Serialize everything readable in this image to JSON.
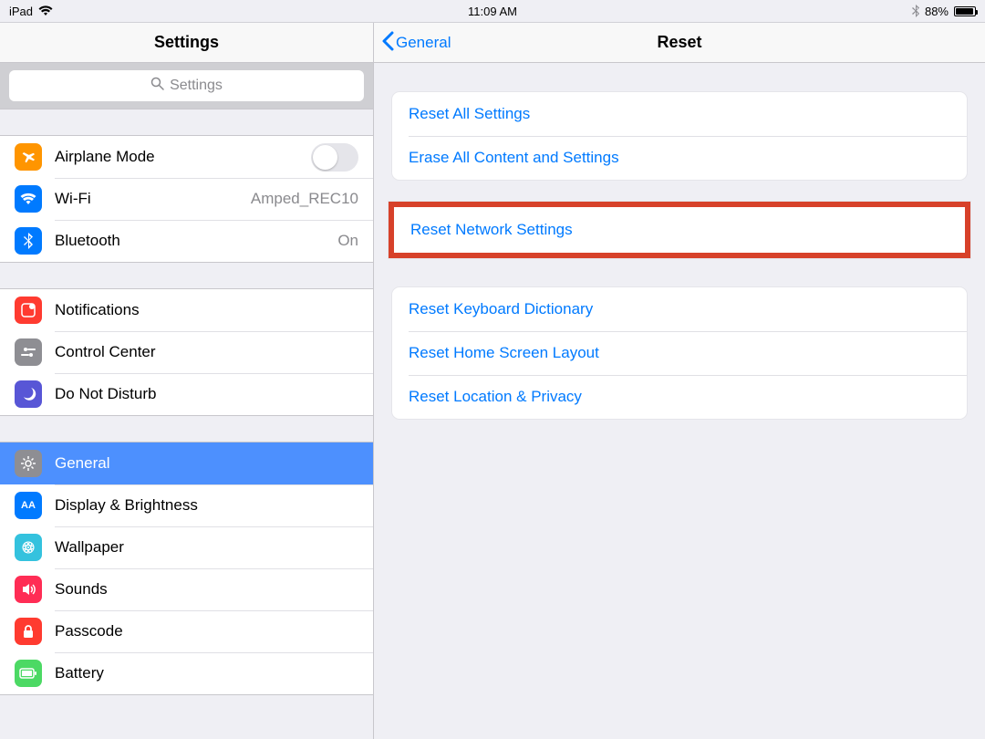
{
  "status": {
    "device": "iPad",
    "time": "11:09 AM",
    "battery_pct": "88%"
  },
  "sidebar": {
    "title": "Settings",
    "search_placeholder": "Settings",
    "group1": {
      "airplane": "Airplane Mode",
      "wifi": "Wi-Fi",
      "wifi_value": "Amped_REC10",
      "bluetooth": "Bluetooth",
      "bluetooth_value": "On"
    },
    "group2": {
      "notifications": "Notifications",
      "control_center": "Control Center",
      "dnd": "Do Not Disturb"
    },
    "group3": {
      "general": "General",
      "display": "Display & Brightness",
      "wallpaper": "Wallpaper",
      "sounds": "Sounds",
      "passcode": "Passcode",
      "battery": "Battery"
    }
  },
  "detail": {
    "back_label": "General",
    "title": "Reset",
    "g1": {
      "reset_all": "Reset All Settings",
      "erase_all": "Erase All Content and Settings"
    },
    "g2": {
      "reset_network": "Reset Network Settings"
    },
    "g3": {
      "reset_keyboard": "Reset Keyboard Dictionary",
      "reset_home": "Reset Home Screen Layout",
      "reset_location": "Reset Location & Privacy"
    }
  }
}
